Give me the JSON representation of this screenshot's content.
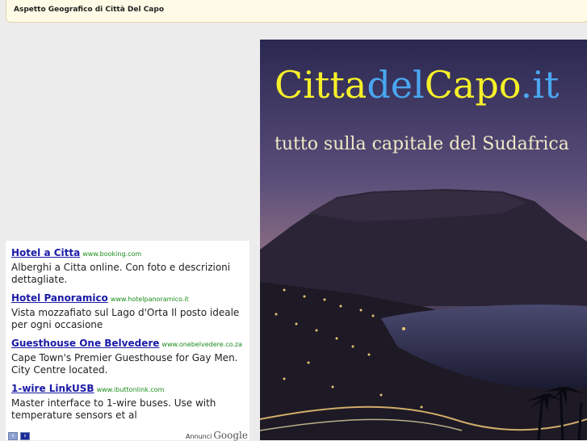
{
  "header": {
    "title": "Aspetto Geografico di Città Del Capo"
  },
  "banner": {
    "logo_part1": "Citta",
    "logo_part2": "del",
    "logo_part3": "Capo",
    "logo_part4": ".it",
    "tagline": "tutto sulla capitale del Sudafrica"
  },
  "ads": {
    "items": [
      {
        "title": "Hotel a Citta",
        "url": "www.booking.com",
        "desc": "Alberghi a Citta online. Con foto e descrizioni dettagliate."
      },
      {
        "title": "Hotel Panoramico",
        "url": "www.hotelpanoramico.it",
        "desc": "Vista mozzafiato sul Lago d'Orta Il posto ideale per ogni occasione"
      },
      {
        "title": "Guesthouse One Belvedere",
        "url": "www.onebelvedere.co.za",
        "desc": "Cape Town's Premier Guesthouse for Gay Men. City Centre located."
      },
      {
        "title": "1-wire LinkUSB",
        "url": "www.ibuttonlink.com",
        "desc": "Master interface to 1-wire buses. Use with temperature sensors et al"
      }
    ],
    "prev_arrow": "‹",
    "next_arrow": "›",
    "footer_label": "Annunci",
    "footer_brand": "Google"
  },
  "colors": {
    "ad_title": "#1a1aa6",
    "ad_url": "#1b8c1b",
    "logo_yellow": "#f6f02a",
    "logo_blue": "#4aa6f0",
    "topbar_bg": "#fffbe6"
  }
}
